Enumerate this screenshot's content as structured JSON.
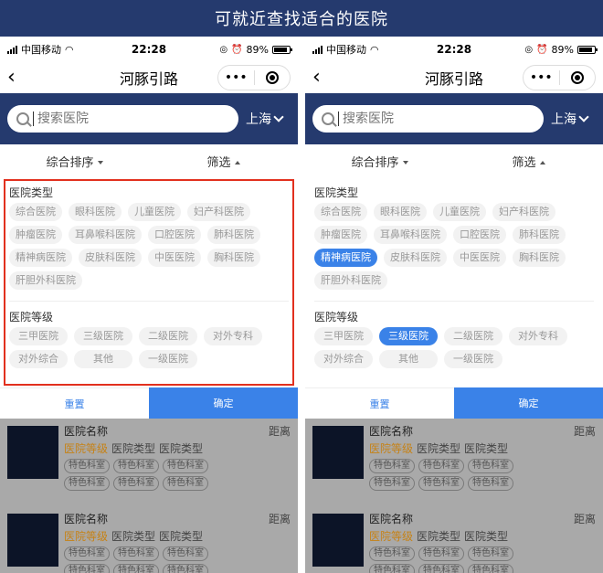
{
  "banner": {
    "title": "可就近查找适合的医院"
  },
  "statusbar": {
    "carrier": "中国移动",
    "time": "22:28",
    "battery": "89%",
    "battery_level": 0.89
  },
  "navbar": {
    "back": "‹",
    "title": "河豚引路",
    "more": "•••"
  },
  "search": {
    "placeholder": "搜索医院",
    "city": "上海"
  },
  "sort": {
    "left": "综合排序",
    "right": "筛选"
  },
  "filter": {
    "type_title": "医院类型",
    "types": [
      "综合医院",
      "眼科医院",
      "儿童医院",
      "妇产科医院",
      "肿瘤医院",
      "耳鼻喉科医院",
      "口腔医院",
      "肺科医院",
      "精神病医院",
      "皮肤科医院",
      "中医医院",
      "胸科医院",
      "肝胆外科医院"
    ],
    "level_title": "医院等级",
    "levels": [
      "三甲医院",
      "三级医院",
      "二级医院",
      "对外专科",
      "对外综合",
      "其他",
      "一级医院"
    ]
  },
  "screens": [
    {
      "selected_type": "",
      "selected_level": "",
      "highlighted": true
    },
    {
      "selected_type": "精神病医院",
      "selected_level": "三级医院",
      "highlighted": false
    }
  ],
  "actions": {
    "reset": "重置",
    "confirm": "确定"
  },
  "list": {
    "name": "医院名称",
    "distance": "距离",
    "level": "医院等级",
    "type": "医院类型",
    "dept": "特色科室"
  },
  "colors": {
    "header": "#253a6e",
    "accent": "#3a82e8",
    "highlight": "#e2301e",
    "level": "#c68216"
  }
}
